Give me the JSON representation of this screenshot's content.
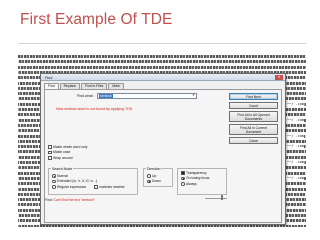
{
  "slide": {
    "title": "First Example Of TDE"
  },
  "dialog": {
    "title": "Find",
    "close_glyph": "✕",
    "tabs": [
      "Find",
      "Replace",
      "Find in Files",
      "Mark"
    ],
    "find_label": "Find what :",
    "find_value": "sentcsh",
    "notice": "Now sentcsh word is not found by applying TDE.",
    "options": [
      "Match whole word only",
      "Match case",
      "Wrap around"
    ],
    "search_mode": {
      "title": "Search Mode",
      "items": [
        "Normal",
        "Extended (\\n, \\r, \\t, \\0, \\x...)",
        "Regular expression"
      ],
      "extra": "matches newline",
      "selected": 0
    },
    "direction": {
      "title": "Direction",
      "items": [
        "Up",
        "Down"
      ],
      "selected": 1
    },
    "transparency": {
      "title": "Transparency",
      "items": [
        "On losing focus",
        "Always"
      ]
    },
    "buttons": [
      "Find Next",
      "Count",
      "Find All in All Opened Documents",
      "Find All in Current Document",
      "Close"
    ],
    "status_prefix": "Find:",
    "status_text": "Can't find the text \"sentcsh\""
  },
  "background": {
    "suffixes": [
      "──/ .com",
      "──/ .com",
      "──/ .com",
      "──/ .com",
      "──/ .com",
      "──/ .com"
    ]
  },
  "colors": {
    "title": "#c0504d",
    "notice": "#d02020",
    "selection": "#3a74c8"
  }
}
